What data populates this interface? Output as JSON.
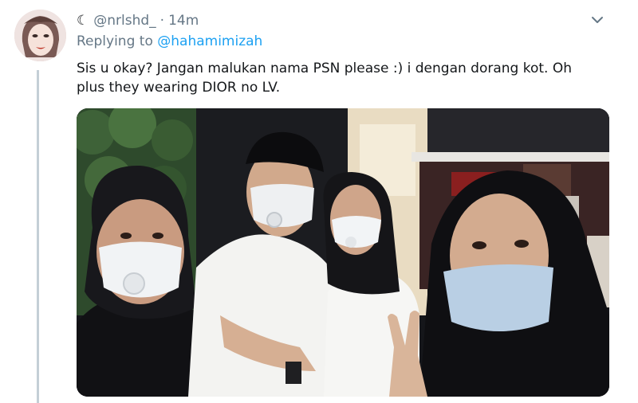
{
  "tweet": {
    "author_icon": "crescent-moon-icon",
    "handle": "@nrlshd_",
    "separator": "·",
    "time": "14m",
    "replying_prefix": "Replying to",
    "replying_to": "@hahamimizah",
    "text": "Sis u okay? Jangan malukan nama PSN please :) i dengan dorang kot. Oh plus they wearing DIOR no LV.",
    "more_icon": "chevron-down-icon",
    "media_description_icon": "photo",
    "colors": {
      "handle": "#657786",
      "mention": "#1da1f2",
      "text": "#14171a",
      "thread_line": "#c4cfd6"
    }
  }
}
